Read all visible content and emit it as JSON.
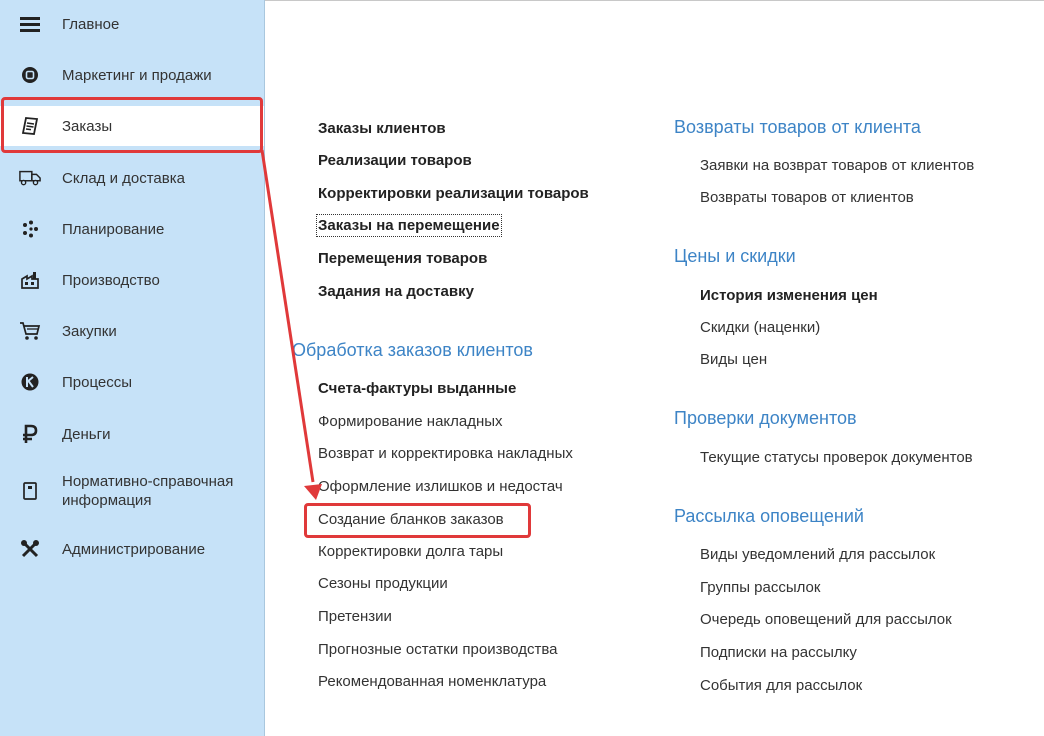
{
  "sidebar": {
    "items": [
      {
        "label": "Главное",
        "icon": "menu-icon"
      },
      {
        "label": "Маркетинг и продажи",
        "icon": "marketing-icon"
      },
      {
        "label": "Заказы",
        "icon": "orders-icon"
      },
      {
        "label": "Склад и доставка",
        "icon": "truck-icon"
      },
      {
        "label": "Планирование",
        "icon": "planning-icon"
      },
      {
        "label": "Производство",
        "icon": "factory-icon"
      },
      {
        "label": "Закупки",
        "icon": "cart-icon"
      },
      {
        "label": "Процессы",
        "icon": "process-icon"
      },
      {
        "label": "Деньги",
        "icon": "ruble-icon"
      },
      {
        "label": "Нормативно-справочная информация",
        "icon": "reference-icon"
      },
      {
        "label": "Администрирование",
        "icon": "tools-icon"
      }
    ],
    "active_index": 2
  },
  "left_column": {
    "top_links": [
      "Заказы клиентов",
      "Реализации товаров",
      "Корректировки реализации товаров",
      "Заказы на перемещение",
      "Перемещения товаров",
      "Задания на доставку"
    ],
    "processing": {
      "title": "Обработка заказов клиентов",
      "links": [
        "Счета-фактуры выданные",
        "Формирование накладных",
        "Возврат и корректировка накладных",
        "Оформление излишков и недостач",
        "Создание бланков заказов",
        "Корректировки долга тары",
        "Сезоны продукции",
        "Претензии",
        "Прогнозные остатки производства",
        "Рекомендованная номенклатура"
      ]
    }
  },
  "right_column": {
    "returns": {
      "title": "Возвраты товаров от клиента",
      "links": [
        "Заявки на возврат товаров от клиентов",
        "Возвраты товаров от клиентов"
      ]
    },
    "prices": {
      "title": "Цены и скидки",
      "links": [
        "История изменения цен",
        "Скидки (наценки)",
        "Виды цен"
      ]
    },
    "checks": {
      "title": "Проверки документов",
      "links": [
        "Текущие статусы проверок документов"
      ]
    },
    "mailing": {
      "title": "Рассылка оповещений",
      "links": [
        "Виды уведомлений для рассылок",
        "Группы рассылок",
        "Очередь оповещений для рассылок",
        "Подписки на рассылку",
        "События для рассылок"
      ]
    }
  },
  "colors": {
    "sidebar_bg": "#c6e2f8",
    "section_title": "#3d84c6",
    "highlight": "#e0393a"
  }
}
